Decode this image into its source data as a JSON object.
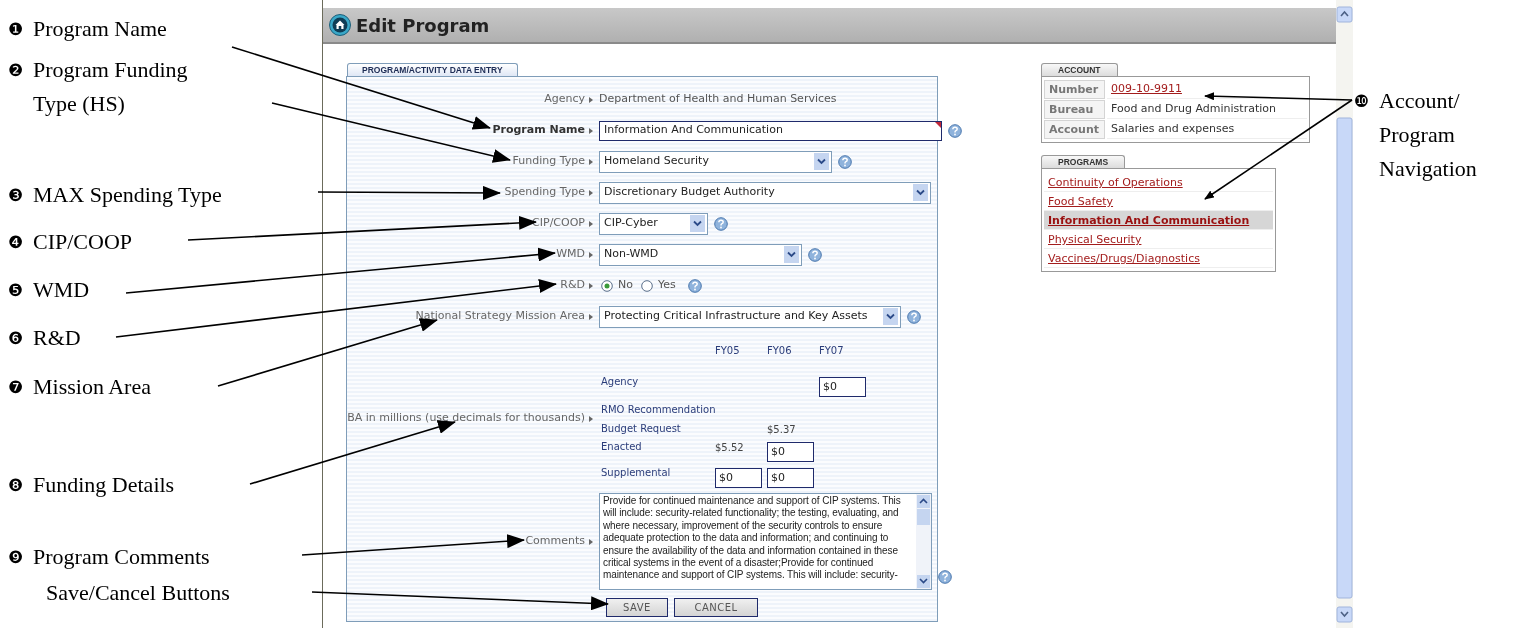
{
  "callouts": [
    {
      "marker": "❶",
      "lines": [
        "Program Name"
      ]
    },
    {
      "marker": "❷",
      "lines": [
        "Program Funding",
        "Type (HS)"
      ]
    },
    {
      "marker": "❸",
      "lines": [
        "MAX Spending Type"
      ]
    },
    {
      "marker": "❹",
      "lines": [
        "CIP/COOP"
      ]
    },
    {
      "marker": "❺",
      "lines": [
        "WMD"
      ]
    },
    {
      "marker": "❻",
      "lines": [
        "R&D"
      ]
    },
    {
      "marker": "❼",
      "lines": [
        "Mission Area"
      ]
    },
    {
      "marker": "❽",
      "lines": [
        "Funding Details"
      ]
    },
    {
      "marker": "❾",
      "lines": [
        "Program Comments"
      ]
    },
    {
      "lines": [
        "Save/Cancel Buttons"
      ]
    },
    {
      "marker": "❿",
      "lines": [
        "Account/",
        "Program",
        "Navigation"
      ]
    }
  ],
  "window": {
    "title": "Edit Program"
  },
  "form": {
    "tab": "PROGRAM/ACTIVITY DATA ENTRY",
    "fields": [
      {
        "kind": "text",
        "label": "Agency",
        "value": "Department of Health and Human Services",
        "help": false
      },
      {
        "kind": "input",
        "label": "Program Name",
        "value": "Information And Communication",
        "help": true,
        "required": true
      },
      {
        "kind": "select",
        "label": "Funding Type",
        "value": "Homeland Security",
        "help": true
      },
      {
        "kind": "select",
        "label": "Spending Type",
        "value": "Discretionary Budget Authority",
        "help": false
      },
      {
        "kind": "select",
        "label": "CIP/COOP",
        "value": "CIP-Cyber",
        "help": true
      },
      {
        "kind": "select",
        "label": "WMD",
        "value": "Non-WMD",
        "help": true
      },
      {
        "kind": "radio",
        "label": "R&D",
        "options": [
          {
            "label": "No",
            "selected": true
          },
          {
            "label": "Yes",
            "selected": false
          }
        ],
        "help": true
      },
      {
        "kind": "select",
        "label": "National Strategy Mission Area",
        "value": "Protecting Critical Infrastructure and Key Assets",
        "help": true
      }
    ],
    "funding": {
      "label": "BA in millions (use decimals for thousands)",
      "years": [
        "FY05",
        "FY06",
        "FY07"
      ],
      "rows": [
        {
          "label": "Agency",
          "cells": [
            {
              "kind": "empty"
            },
            {
              "kind": "empty"
            },
            {
              "kind": "input",
              "value": "$0"
            }
          ]
        },
        {
          "label": "RMO Recommendation",
          "cells": [
            {
              "kind": "empty"
            },
            {
              "kind": "empty"
            },
            {
              "kind": "empty"
            }
          ]
        },
        {
          "label": "Budget Request",
          "cells": [
            {
              "kind": "empty"
            },
            {
              "kind": "text",
              "value": "$5.37"
            },
            {
              "kind": "empty"
            }
          ]
        },
        {
          "label": "Enacted",
          "cells": [
            {
              "kind": "text",
              "value": "$5.52"
            },
            {
              "kind": "input",
              "value": "$0"
            },
            {
              "kind": "empty"
            }
          ]
        },
        {
          "label": "Supplemental",
          "cells": [
            {
              "kind": "input",
              "value": "$0"
            },
            {
              "kind": "input",
              "value": "$0"
            },
            {
              "kind": "empty"
            }
          ]
        }
      ]
    },
    "comments": {
      "label": "Comments",
      "value": "Provide for continued maintenance and support of CIP systems.  This will include: security-related functionality; the testing, evaluating, and where necessary, improvement of the security controls to ensure adequate protection to the data and information; and continuing to ensure the availability of the data and information contained in these critical systems in the event of a disaster;Provide for continued maintenance and support of CIP systems.  This will include: security-",
      "help": true
    },
    "buttons": [
      "SAVE",
      "CANCEL"
    ]
  },
  "account": {
    "tab": "ACCOUNT",
    "rows": [
      {
        "key": "Number",
        "value": "009-10-9911",
        "link": true
      },
      {
        "key": "Bureau",
        "value": "Food and Drug Administration",
        "link": false
      },
      {
        "key": "Account",
        "value": "Salaries and expenses",
        "link": false
      }
    ]
  },
  "programs": {
    "tab": "PROGRAMS",
    "items": [
      {
        "label": "Continuity of Operations",
        "selected": false
      },
      {
        "label": "Food Safety",
        "selected": false
      },
      {
        "label": "Information And Communication",
        "selected": true
      },
      {
        "label": "Physical Security",
        "selected": false
      },
      {
        "label": "Vaccines/Drugs/Diagnostics",
        "selected": false
      }
    ]
  }
}
